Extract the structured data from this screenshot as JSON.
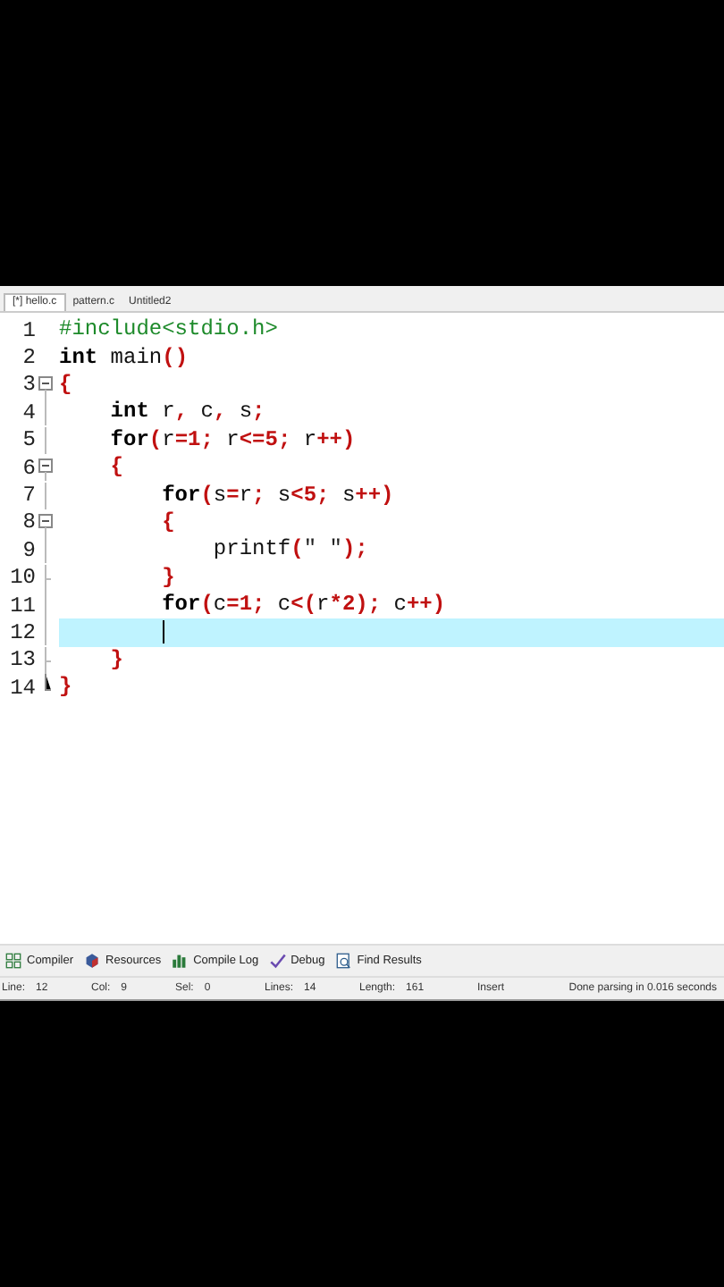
{
  "file_tabs": [
    {
      "label": "[*] hello.c",
      "selected": true
    },
    {
      "label": "pattern.c",
      "selected": false
    },
    {
      "label": "Untitled2",
      "selected": false
    }
  ],
  "editor": {
    "lines": [
      {
        "number": "1",
        "kind": "plain",
        "current": false,
        "tokens": [
          {
            "kind": "preproc",
            "text": "#include<stdio.h>"
          }
        ]
      },
      {
        "number": "2",
        "kind": "plain",
        "current": false,
        "tokens": [
          {
            "kind": "keyword",
            "text": "int"
          },
          {
            "kind": "plain",
            "text": " main"
          },
          {
            "kind": "symbol",
            "text": "()"
          }
        ]
      },
      {
        "number": "3",
        "kind": "start",
        "current": false,
        "tokens": [
          {
            "kind": "symbol",
            "text": "{"
          }
        ]
      },
      {
        "number": "4",
        "kind": "inner",
        "current": false,
        "tokens": [
          {
            "kind": "keyword",
            "text": "    int"
          },
          {
            "kind": "plain",
            "text": " r"
          },
          {
            "kind": "symbol",
            "text": ","
          },
          {
            "kind": "plain",
            "text": " c"
          },
          {
            "kind": "symbol",
            "text": ","
          },
          {
            "kind": "plain",
            "text": " s"
          },
          {
            "kind": "symbol",
            "text": ";"
          }
        ]
      },
      {
        "number": "5",
        "kind": "inner",
        "current": false,
        "tokens": [
          {
            "kind": "keyword",
            "text": "    for"
          },
          {
            "kind": "symbol",
            "text": "("
          },
          {
            "kind": "plain",
            "text": "r"
          },
          {
            "kind": "symbol",
            "text": "=1;"
          },
          {
            "kind": "plain",
            "text": " r"
          },
          {
            "kind": "symbol",
            "text": "<=5;"
          },
          {
            "kind": "plain",
            "text": " r"
          },
          {
            "kind": "symbol",
            "text": "++)"
          }
        ]
      },
      {
        "number": "6",
        "kind": "start",
        "current": false,
        "tokens": [
          {
            "kind": "symbol",
            "text": "    {"
          }
        ]
      },
      {
        "number": "7",
        "kind": "inner",
        "current": false,
        "tokens": [
          {
            "kind": "keyword",
            "text": "        for"
          },
          {
            "kind": "symbol",
            "text": "("
          },
          {
            "kind": "plain",
            "text": "s"
          },
          {
            "kind": "symbol",
            "text": "="
          },
          {
            "kind": "plain",
            "text": "r"
          },
          {
            "kind": "symbol",
            "text": ";"
          },
          {
            "kind": "plain",
            "text": " s"
          },
          {
            "kind": "symbol",
            "text": "<5;"
          },
          {
            "kind": "plain",
            "text": " s"
          },
          {
            "kind": "symbol",
            "text": "++)"
          }
        ]
      },
      {
        "number": "8",
        "kind": "start",
        "current": false,
        "tokens": [
          {
            "kind": "symbol",
            "text": "        {"
          }
        ]
      },
      {
        "number": "9",
        "kind": "inner",
        "current": false,
        "tokens": [
          {
            "kind": "plain",
            "text": "            printf"
          },
          {
            "kind": "symbol",
            "text": "("
          },
          {
            "kind": "string",
            "text": "\" \""
          },
          {
            "kind": "symbol",
            "text": ");"
          }
        ]
      },
      {
        "number": "10",
        "kind": "end",
        "current": false,
        "tokens": [
          {
            "kind": "symbol",
            "text": "        }"
          }
        ]
      },
      {
        "number": "11",
        "kind": "inner",
        "current": false,
        "tokens": [
          {
            "kind": "keyword",
            "text": "        for"
          },
          {
            "kind": "symbol",
            "text": "("
          },
          {
            "kind": "plain",
            "text": "c"
          },
          {
            "kind": "symbol",
            "text": "=1;"
          },
          {
            "kind": "plain",
            "text": " c"
          },
          {
            "kind": "symbol",
            "text": "<("
          },
          {
            "kind": "plain",
            "text": "r"
          },
          {
            "kind": "symbol",
            "text": "*2);"
          },
          {
            "kind": "plain",
            "text": " c"
          },
          {
            "kind": "symbol",
            "text": "++)"
          }
        ]
      },
      {
        "number": "12",
        "kind": "inner",
        "current": true
      },
      {
        "number": "13",
        "kind": "end",
        "current": false,
        "tokens": [
          {
            "kind": "symbol",
            "text": "    }"
          }
        ]
      },
      {
        "number": "14",
        "kind": "last",
        "current": false,
        "tokens": [
          {
            "kind": "symbol",
            "text": "}"
          }
        ]
      }
    ]
  },
  "bottom_tabs": [
    {
      "label": "Compiler"
    },
    {
      "label": "Resources"
    },
    {
      "label": "Compile Log"
    },
    {
      "label": "Debug"
    },
    {
      "label": "Find Results"
    }
  ],
  "status_bar": [
    {
      "label": "Line:",
      "value": "12"
    },
    {
      "label": "Col:",
      "value": "9"
    },
    {
      "label": "Sel:",
      "value": "0"
    },
    {
      "label": "Lines:",
      "value": "14"
    },
    {
      "label": "Length:",
      "value": "161"
    },
    {
      "label": "Insert"
    },
    {
      "label": "Done parsing in 0.016 seconds"
    }
  ]
}
